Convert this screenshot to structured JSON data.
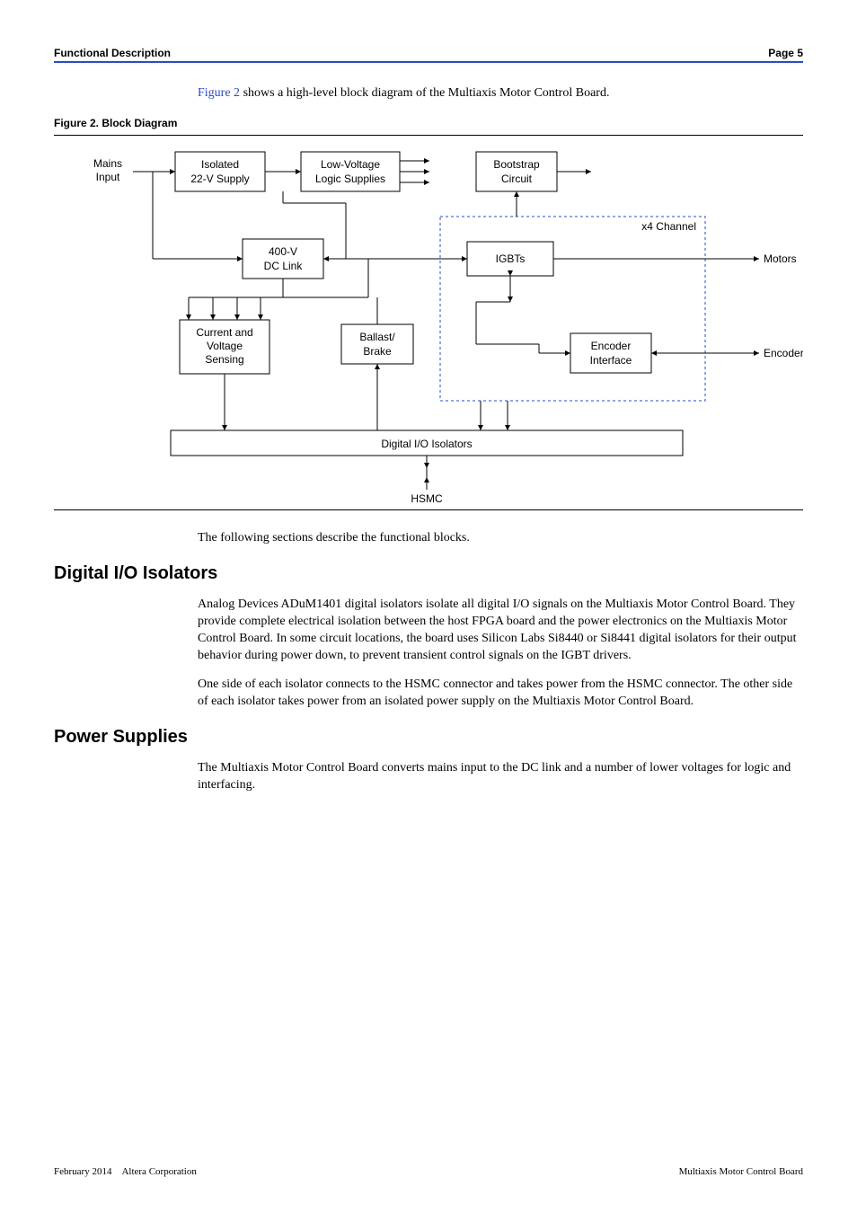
{
  "page": {
    "hdr_left": "Functional Description",
    "hdr_right": "Page 5",
    "intro_link": "Figure 2",
    "intro_rest": " shows a high-level block diagram of the Multiaxis Motor Control Board.",
    "figcap": "Figure 2.  Block Diagram"
  },
  "diagram": {
    "mains": "Mains",
    "input": "Input",
    "isolated1": "Isolated",
    "isolated2": "22-V Supply",
    "lowv1": "Low-Voltage",
    "lowv2": "Logic Supplies",
    "boot1": "Bootstrap",
    "boot2": "Circuit",
    "dc1": "400-V",
    "dc2": "DC Link",
    "igbt": "IGBTs",
    "chan": "x4 Channel",
    "cvs1": "Current and",
    "cvs2": "Voltage",
    "cvs3": "Sensing",
    "ballast1": "Ballast/",
    "ballast2": "Brake",
    "enc1": "Encoder",
    "enc2": "Interface",
    "motors": "Motors",
    "encoders": "Encoders",
    "dio": "Digital I/O Isolators",
    "hsmc": "HSMC"
  },
  "body": {
    "afterfig": "The following sections describe the functional blocks.",
    "sec1_title": "Digital I/O Isolators",
    "sec1_p1": "Analog Devices ADuM1401 digital isolators isolate all digital I/O signals on the Multiaxis Motor Control Board. They provide complete electrical isolation between the host FPGA board and the power electronics on the Multiaxis Motor Control Board. In some circuit locations, the board uses Silicon Labs Si8440 or Si8441 digital isolators for their output behavior during power down, to prevent transient control signals on the IGBT drivers.",
    "sec1_p2": "One side of each isolator connects to the HSMC connector and takes power from the HSMC connector. The other side of each isolator takes power from an isolated power supply on the Multiaxis Motor Control Board.",
    "sec2_title": "Power Supplies",
    "sec2_p1": "The Multiaxis Motor Control Board converts mains input to the DC link and a number of lower voltages for logic and interfacing."
  },
  "footer": {
    "left": "February 2014 Altera Corporation",
    "right": "Multiaxis Motor Control Board"
  }
}
